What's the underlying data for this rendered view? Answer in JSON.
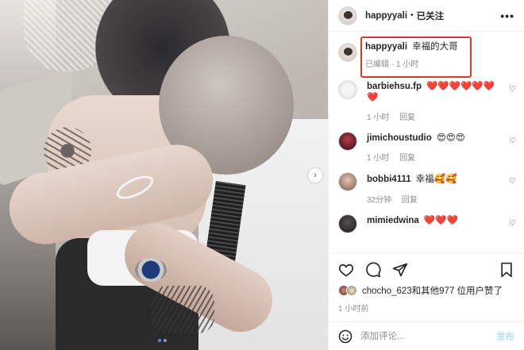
{
  "header": {
    "username": "happyyali",
    "separator": "•",
    "follow_state": "已关注",
    "more_icon": "more-horizontal-icon"
  },
  "caption": {
    "username": "happyyali",
    "text": "幸福的大哥",
    "edited": "已编辑 · 1 小时"
  },
  "comments": [
    {
      "username": "barbiehsu.fp",
      "text": "❤️❤️❤️❤️❤️❤️❤️",
      "time": "1 小时",
      "reply": "回复"
    },
    {
      "username": "jimichoustudio",
      "text": "😍😍😍",
      "time": "1 小时",
      "reply": "回复"
    },
    {
      "username": "bobbi4111",
      "text": "幸福🥰🥰",
      "time": "32分钟",
      "reply": "回复"
    },
    {
      "username": "mimiedwina",
      "text": "❤️❤️❤️",
      "time": "",
      "reply": ""
    }
  ],
  "likes": {
    "text_prefix": "chocho_623和其他977 位用户赞了"
  },
  "post_time": "1 小时前",
  "composer": {
    "placeholder": "添加评论...",
    "post_label": "发布"
  },
  "carousel": {
    "current": 1,
    "total": 2
  },
  "colors": {
    "highlight_box": "#e0352b",
    "link_blue": "#b2dffc",
    "active_dot": "#3897f0"
  }
}
